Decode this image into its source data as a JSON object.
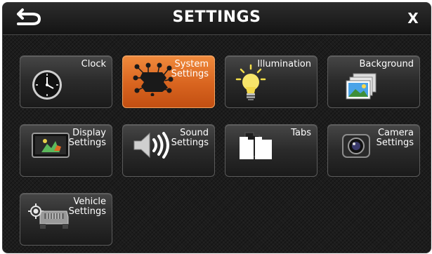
{
  "header": {
    "title": "SETTINGS",
    "close_label": "X",
    "back_icon": "back-arrow-icon"
  },
  "tiles": [
    {
      "label": "Clock",
      "icon": "clock-icon",
      "selected": false
    },
    {
      "label": "System\nSettings",
      "icon": "system-settings-icon",
      "selected": true
    },
    {
      "label": "Illumination",
      "icon": "light-bulb-icon",
      "selected": false
    },
    {
      "label": "Background",
      "icon": "picture-icon",
      "selected": false
    },
    {
      "label": "Display\nSettings",
      "icon": "display-icon",
      "selected": false
    },
    {
      "label": "Sound\nSettings",
      "icon": "speaker-icon",
      "selected": false
    },
    {
      "label": "Tabs",
      "icon": "tabs-icon",
      "selected": false
    },
    {
      "label": "Camera\nSettings",
      "icon": "camera-icon",
      "selected": false
    },
    {
      "label": "Vehicle\nSettings",
      "icon": "vehicle-icon",
      "selected": false
    }
  ],
  "colors": {
    "accent": "#e06a22",
    "background": "#1c1c1c",
    "text": "#ffffff"
  }
}
